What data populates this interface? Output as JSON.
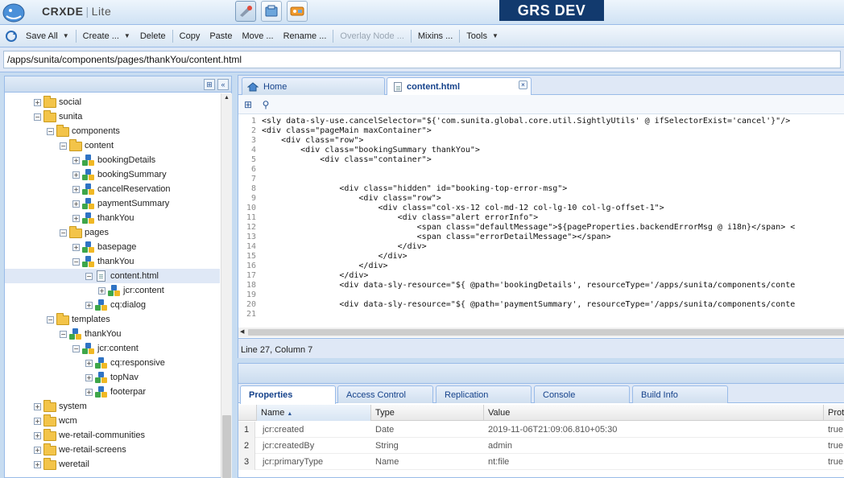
{
  "header": {
    "app_name": "CRXDE",
    "app_edition": "Lite",
    "environment": "GRS DEV",
    "mode_buttons": [
      "crxde-mode-icon",
      "package-manager-icon",
      "console-icon"
    ]
  },
  "toolbar": {
    "save_all": "Save All",
    "create": "Create ...",
    "delete": "Delete",
    "copy": "Copy",
    "paste": "Paste",
    "move": "Move ...",
    "rename": "Rename ...",
    "overlay_node": "Overlay Node ...",
    "mixins": "Mixins ...",
    "tools": "Tools"
  },
  "path": {
    "value": "/apps/sunita/components/pages/thankYou/content.html"
  },
  "tree": {
    "items": [
      {
        "label": "social",
        "type": "folder",
        "depth": 2,
        "expander": "+"
      },
      {
        "label": "sunita",
        "type": "folder",
        "depth": 2,
        "expander": "-"
      },
      {
        "label": "components",
        "type": "folder",
        "depth": 3,
        "expander": "-"
      },
      {
        "label": "content",
        "type": "folder",
        "depth": 4,
        "expander": "-"
      },
      {
        "label": "bookingDetails",
        "type": "node",
        "depth": 5,
        "expander": "+"
      },
      {
        "label": "bookingSummary",
        "type": "node",
        "depth": 5,
        "expander": "+"
      },
      {
        "label": "cancelReservation",
        "type": "node",
        "depth": 5,
        "expander": "+"
      },
      {
        "label": "paymentSummary",
        "type": "node",
        "depth": 5,
        "expander": "+"
      },
      {
        "label": "thankYou",
        "type": "node",
        "depth": 5,
        "expander": "+"
      },
      {
        "label": "pages",
        "type": "folder",
        "depth": 4,
        "expander": "-"
      },
      {
        "label": "basepage",
        "type": "node",
        "depth": 5,
        "expander": "+"
      },
      {
        "label": "thankYou",
        "type": "node",
        "depth": 5,
        "expander": "-"
      },
      {
        "label": "content.html",
        "type": "file",
        "depth": 6,
        "expander": "-",
        "selected": true
      },
      {
        "label": "jcr:content",
        "type": "node",
        "depth": 7,
        "expander": "+"
      },
      {
        "label": "cq:dialog",
        "type": "node",
        "depth": 6,
        "expander": "+"
      },
      {
        "label": "templates",
        "type": "folder",
        "depth": 3,
        "expander": "-"
      },
      {
        "label": "thankYou",
        "type": "node",
        "depth": 4,
        "expander": "-"
      },
      {
        "label": "jcr:content",
        "type": "node",
        "depth": 5,
        "expander": "-"
      },
      {
        "label": "cq:responsive",
        "type": "node",
        "depth": 6,
        "expander": "+"
      },
      {
        "label": "topNav",
        "type": "node",
        "depth": 6,
        "expander": "+"
      },
      {
        "label": "footerpar",
        "type": "node",
        "depth": 6,
        "expander": "+"
      },
      {
        "label": "system",
        "type": "folder",
        "depth": 2,
        "expander": "+"
      },
      {
        "label": "wcm",
        "type": "folder",
        "depth": 2,
        "expander": "+"
      },
      {
        "label": "we-retail-communities",
        "type": "folder",
        "depth": 2,
        "expander": "+"
      },
      {
        "label": "we-retail-screens",
        "type": "folder",
        "depth": 2,
        "expander": "+"
      },
      {
        "label": "weretail",
        "type": "folder",
        "depth": 2,
        "expander": "+"
      }
    ]
  },
  "editor": {
    "tabs": [
      {
        "label": "Home",
        "icon": "home-icon"
      },
      {
        "label": "content.html",
        "icon": "file-icon",
        "active": true
      }
    ],
    "tools": [
      "format-icon",
      "find-icon"
    ],
    "lines": [
      {
        "n": "1",
        "text": "<sly data-sly-use.cancelSelector=\"${'com.sunita.global.core.util.SightlyUtils' @ ifSelectorExist='cancel'}\"/>"
      },
      {
        "n": "2",
        "text": "<div class=\"pageMain maxContainer\">"
      },
      {
        "n": "3",
        "text": "    <div class=\"row\">"
      },
      {
        "n": "4",
        "text": "        <div class=\"bookingSummary thankYou\">"
      },
      {
        "n": "5",
        "text": "            <div class=\"container\">"
      },
      {
        "n": "6",
        "text": ""
      },
      {
        "n": "7",
        "text": ""
      },
      {
        "n": "8",
        "text": "                <div class=\"hidden\" id=\"booking-top-error-msg\">"
      },
      {
        "n": "9",
        "text": "                    <div class=\"row\">"
      },
      {
        "n": "10",
        "text": "                        <div class=\"col-xs-12 col-md-12 col-lg-10 col-lg-offset-1\">"
      },
      {
        "n": "11",
        "text": "                            <div class=\"alert errorInfo\">"
      },
      {
        "n": "12",
        "text": "                                <span class=\"defaultMessage\">${pageProperties.backendErrorMsg @ i18n}</span> <"
      },
      {
        "n": "13",
        "text": "                                <span class=\"errorDetailMessage\"></span>"
      },
      {
        "n": "14",
        "text": "                            </div>"
      },
      {
        "n": "15",
        "text": "                        </div>"
      },
      {
        "n": "16",
        "text": "                    </div>"
      },
      {
        "n": "17",
        "text": "                </div>"
      },
      {
        "n": "18",
        "text": "                <div data-sly-resource=\"${ @path='bookingDetails', resourceType='/apps/sunita/components/conte"
      },
      {
        "n": "19",
        "text": ""
      },
      {
        "n": "20",
        "text": "                <div data-sly-resource=\"${ @path='paymentSummary', resourceType='/apps/sunita/components/conte"
      },
      {
        "n": "21",
        "text": ""
      }
    ],
    "status": "Line 27, Column 7"
  },
  "properties": {
    "tabs": [
      "Properties",
      "Access Control",
      "Replication",
      "Console",
      "Build Info"
    ],
    "columns": [
      "Name",
      "Type",
      "Value",
      "Prot"
    ],
    "rows": [
      {
        "num": "1",
        "name": "jcr:created",
        "type": "Date",
        "value": "2019-11-06T21:09:06.810+05:30",
        "prot": "true"
      },
      {
        "num": "2",
        "name": "jcr:createdBy",
        "type": "String",
        "value": "admin",
        "prot": "true"
      },
      {
        "num": "3",
        "name": "jcr:primaryType",
        "type": "Name",
        "value": "nt:file",
        "prot": "true"
      }
    ]
  }
}
